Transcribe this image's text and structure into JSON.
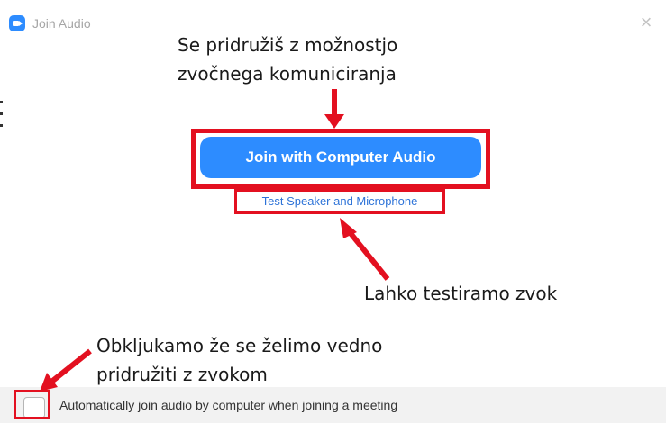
{
  "window": {
    "title": "Join Audio",
    "close_symbol": "×"
  },
  "dialog": {
    "join_button_label": "Join with Computer Audio",
    "test_link_label": "Test Speaker and Microphone",
    "auto_join_checked": false,
    "auto_join_label": "Automatically join audio by computer when joining a meeting"
  },
  "annotations": {
    "top_line1": "Se pridružiš z možnostjo",
    "top_line2": "zvočnega komuniciranja",
    "right": "Lahko testiramo zvok",
    "bottom_line1": "Obkljukamo že se želimo vedno",
    "bottom_line2": "pridružiti z zvokom"
  },
  "colors": {
    "accent_blue": "#2d8cff",
    "link_blue": "#2d73d8",
    "highlight_red": "#e31020"
  },
  "icons": {
    "app": "zoom-camera-icon",
    "close": "close-icon"
  }
}
